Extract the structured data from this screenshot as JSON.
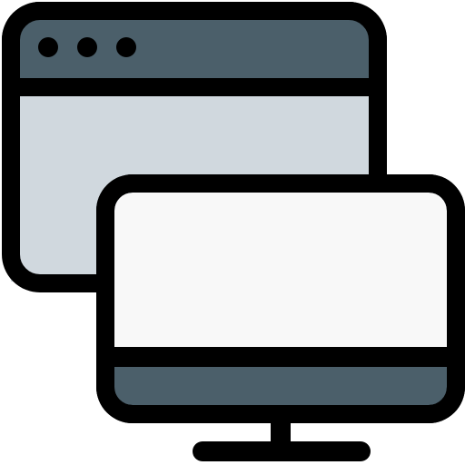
{
  "icon": {
    "name": "browser-window-and-monitor-icon",
    "parts": [
      "browser-window-icon",
      "monitor-icon"
    ]
  },
  "colors": {
    "outline": "#000000",
    "dark_slate": "#4b5f6a",
    "light_gray_blue": "#d0d8de",
    "screen_white": "#f8f8f8",
    "background": "#ffffff"
  }
}
